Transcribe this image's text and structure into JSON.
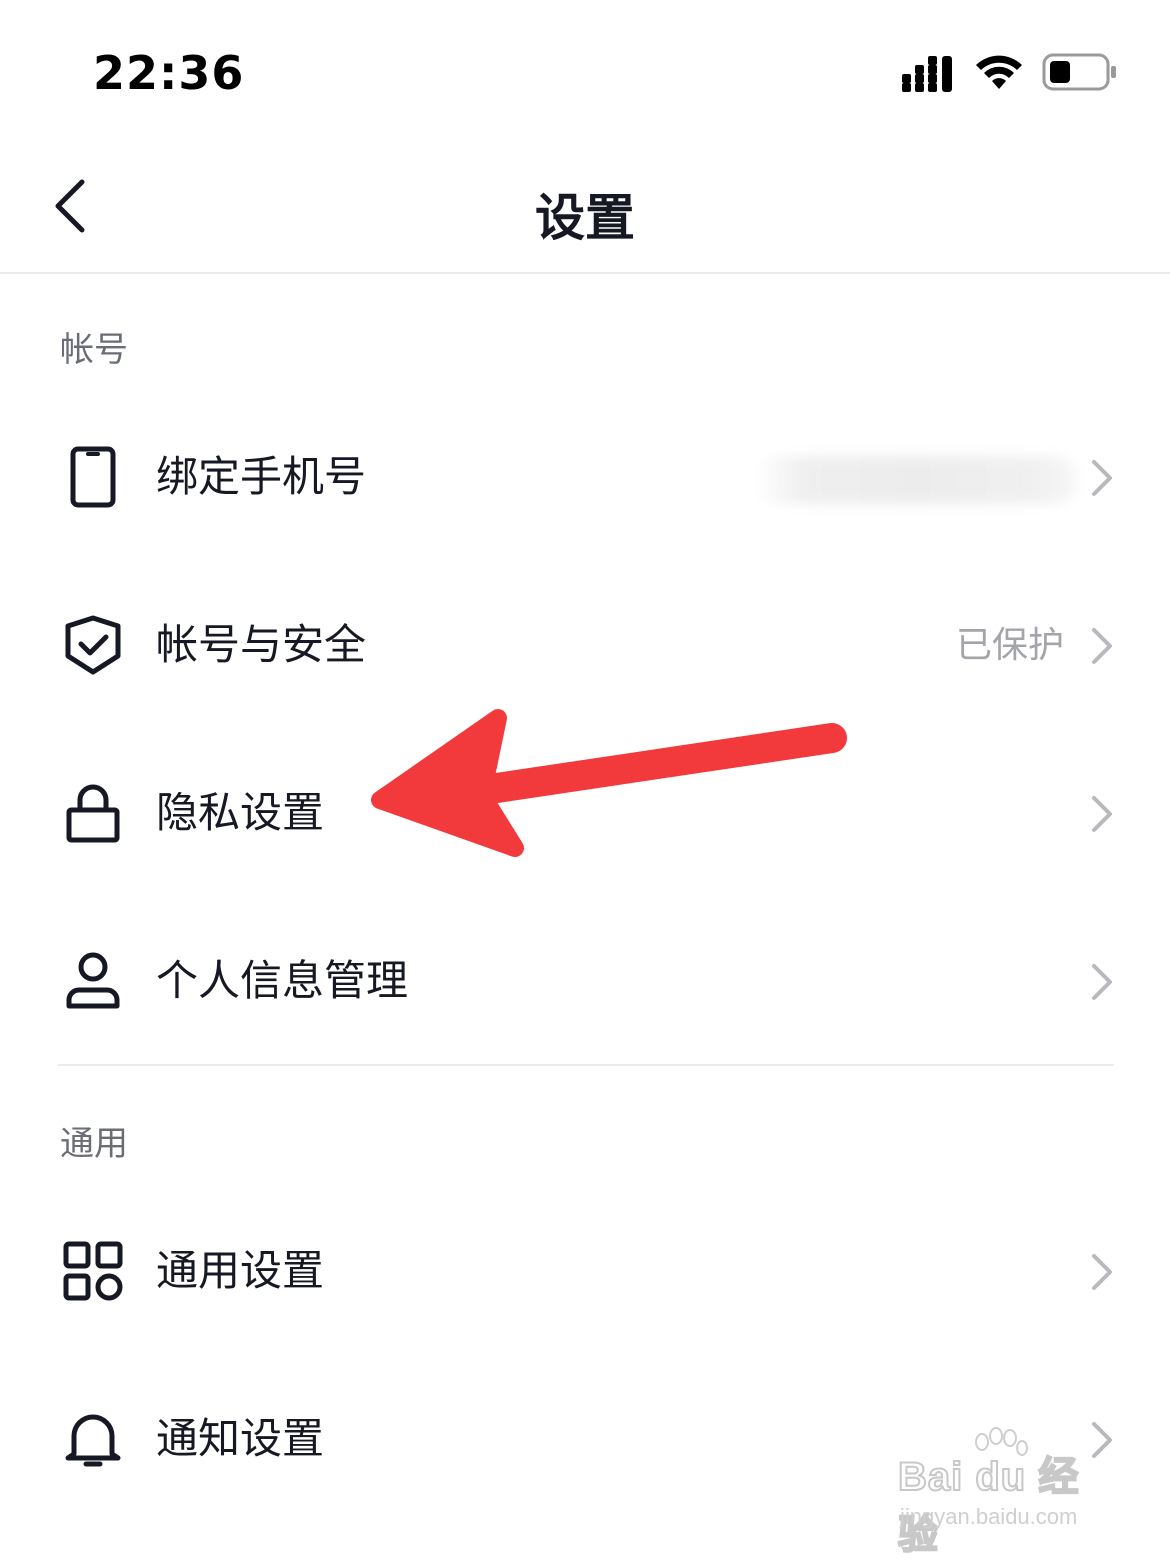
{
  "status_bar": {
    "time": "22:36",
    "icons": [
      "cellular-signal-icon",
      "wifi-icon",
      "battery-icon"
    ]
  },
  "nav": {
    "title": "设置",
    "back_icon": "chevron-left-icon"
  },
  "sections": [
    {
      "header": "帐号",
      "rows": [
        {
          "label": "绑定手机号",
          "value": "",
          "value_blurred": true,
          "icon": "phone-icon"
        },
        {
          "label": "帐号与安全",
          "value": "已保护",
          "icon": "shield-check-icon"
        },
        {
          "label": "隐私设置",
          "value": "",
          "icon": "lock-icon"
        },
        {
          "label": "个人信息管理",
          "value": "",
          "icon": "user-icon"
        }
      ]
    },
    {
      "header": "通用",
      "rows": [
        {
          "label": "通用设置",
          "value": "",
          "icon": "grid-apps-icon"
        },
        {
          "label": "通知设置",
          "value": "",
          "icon": "bell-icon"
        }
      ]
    }
  ],
  "annotation": {
    "color": "#f23a3c",
    "points_to": "隐私设置"
  },
  "watermark": {
    "logo": "Bai du 经验",
    "url": "jingyan.baidu.com"
  },
  "colors": {
    "text_primary": "#161823",
    "text_secondary": "#6b6d76",
    "text_value": "#a4a5aa",
    "divider": "#ececec",
    "arrow": "#f23a3c"
  }
}
